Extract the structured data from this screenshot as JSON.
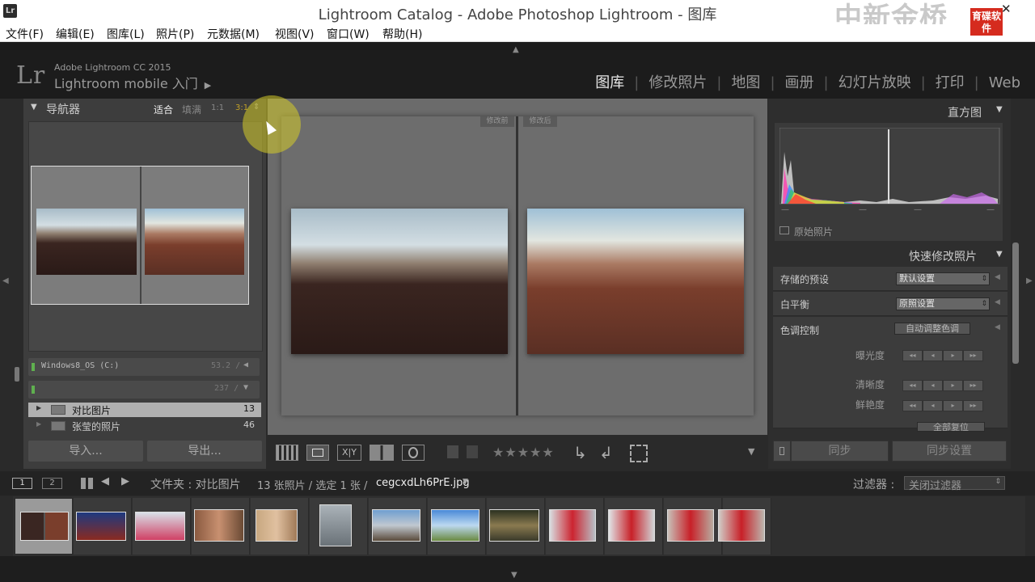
{
  "titlebar": {
    "logo": "Lr",
    "title": "Lightroom Catalog - Adobe Photoshop Lightroom - 图库",
    "watermark": "中新金桥",
    "watermark_logo": "育碟软件",
    "close": "✕"
  },
  "menu": [
    "文件(F)",
    "编辑(E)",
    "图库(L)",
    "照片(P)",
    "元数据(M)",
    "视图(V)",
    "窗口(W)",
    "帮助(H)"
  ],
  "identity": {
    "logo": "Lr",
    "product": "Adobe Lightroom CC 2015",
    "mobile": "Lightroom mobile 入门",
    "mobile_arrow": "▶"
  },
  "modules": [
    {
      "label": "图库",
      "active": true
    },
    {
      "label": "修改照片"
    },
    {
      "label": "地图"
    },
    {
      "label": "画册"
    },
    {
      "label": "幻灯片放映"
    },
    {
      "label": "打印"
    },
    {
      "label": "Web"
    }
  ],
  "navigator": {
    "title": "导航器",
    "triangle": "▼",
    "zoom": [
      "适合",
      "填满",
      "1:1",
      "3:1"
    ],
    "zoom_arrow": "⇕"
  },
  "volumes": [
    {
      "name": "Windows8_OS (C:)",
      "size": "53.2 /",
      "arrow": "◀"
    },
    {
      "name": "",
      "size": "237 /",
      "arrow": "▼"
    }
  ],
  "folders": [
    {
      "name": "对比图片",
      "count": "13"
    },
    {
      "name": "张莹的照片",
      "count": "46"
    }
  ],
  "left_buttons": {
    "import": "导入...",
    "export": "导出..."
  },
  "compare": {
    "before": "修改前",
    "after": "修改后"
  },
  "toolbar": {
    "stars": "★★★★★",
    "more": "▼"
  },
  "right": {
    "histogram_title": "直方图",
    "histogram_triangle": "▼",
    "dashes": [
      "—",
      "—",
      "—",
      "—"
    ],
    "original_photo": "原始照片",
    "quick_develop": "快速修改照片",
    "qd_triangle": "▼",
    "saved_preset_label": "存储的预设",
    "saved_preset_value": "默认设置",
    "white_balance_label": "白平衡",
    "white_balance_value": "原照设置",
    "tone_control_label": "色调控制",
    "auto_tone": "自动调整色调",
    "exposure_label": "曝光度",
    "clarity_label": "清晰度",
    "vibrance_label": "鲜艳度",
    "stepper": [
      "◂◂",
      "◂",
      "▸",
      "▸▸"
    ],
    "reset_all": "全部复位",
    "side_arrow": "◀",
    "sync": "同步",
    "sync_settings": "同步设置"
  },
  "filmbar": {
    "page1": "1",
    "page2": "2",
    "source": "文件夹 : 对比图片",
    "info": "13 张照片 / 选定 1 张 /",
    "filename": "cegcxdLh6PrE.jpg",
    "file_arrow": "▼",
    "filter_label": "过滤器 :",
    "filter_value": "关闭过滤器",
    "filter_arrow": "⇕"
  },
  "icons": {
    "grid": "grid-view-icon",
    "loupe": "loupe-view-icon",
    "compare": "compare-view-icon",
    "survey": "survey-view-icon",
    "people": "people-view-icon",
    "flag": "flag-icon",
    "reject": "reject-flag-icon",
    "rotate_left": "rotate-left-icon",
    "rotate_right": "rotate-right-icon",
    "crop": "crop-overlay-icon"
  },
  "arrows": {
    "up": "▲",
    "down": "▼",
    "left": "◀",
    "right": "▶",
    "prev": "🡐",
    "next": "🡒"
  }
}
